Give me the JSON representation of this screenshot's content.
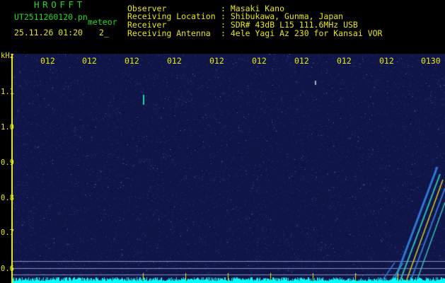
{
  "header": {
    "title": "HROFFT",
    "filename": "UT2511260120.pn",
    "meteor_label": "meteor",
    "datetime": "25.11.26 01:20",
    "count": "2_",
    "fields": [
      {
        "label": "Observer",
        "value": ": Masaki Kano"
      },
      {
        "label": "Receiving Location",
        "value": ": Shibukawa, Gunma, Japan"
      },
      {
        "label": "Receiver",
        "value": ": SDR# 43dB L15 111.6MHz USB"
      },
      {
        "label": "Receiving Antenna",
        "value": ": 4ele Yagi Az 230 for Kansai VOR"
      }
    ]
  },
  "x_ticks": [
    "012",
    "012",
    "012",
    "012",
    "012",
    "012",
    "012",
    "012",
    "012",
    "0130"
  ],
  "y_unit": "kHz",
  "y_ticks": [
    "1.1",
    "1.0",
    "0.9",
    "0.8",
    "0.7",
    "0.6"
  ],
  "colors": {
    "background": "#0f1547",
    "header_text": "#e8e800",
    "title_text": "#23d923",
    "baseline": "#00ffff"
  }
}
